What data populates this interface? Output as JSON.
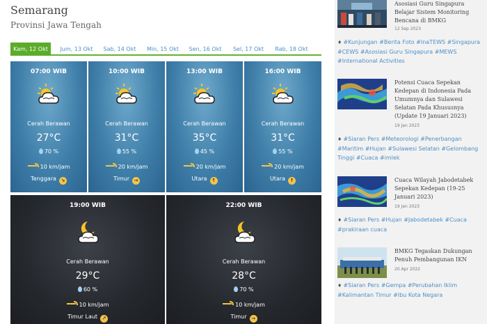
{
  "location": {
    "city": "Semarang",
    "province": "Provinsi Jawa Tengah"
  },
  "tabs": [
    {
      "label": "Kam, 12 Okt",
      "active": true
    },
    {
      "label": "Jum, 13 Okt"
    },
    {
      "label": "Sab, 14 Okt"
    },
    {
      "label": "Min, 15 Okt"
    },
    {
      "label": "Sen, 16 Okt"
    },
    {
      "label": "Sel, 17 Okt"
    },
    {
      "label": "Rab, 18 Okt"
    }
  ],
  "forecasts": [
    {
      "time": "07:00 WIB",
      "condition": "Cerah Berawan",
      "temp": "27°C",
      "humidity": "70 %",
      "wind": "10 km/jam",
      "direction": "Tenggara",
      "period": "day"
    },
    {
      "time": "10:00 WIB",
      "condition": "Cerah Berawan",
      "temp": "31°C",
      "humidity": "55 %",
      "wind": "20 km/jam",
      "direction": "Timur",
      "period": "day"
    },
    {
      "time": "13:00 WIB",
      "condition": "Cerah Berawan",
      "temp": "35°C",
      "humidity": "45 %",
      "wind": "20 km/jam",
      "direction": "Utara",
      "period": "day"
    },
    {
      "time": "16:00 WIB",
      "condition": "Cerah Berawan",
      "temp": "31°C",
      "humidity": "55 %",
      "wind": "20 km/jam",
      "direction": "Utara",
      "period": "day"
    },
    {
      "time": "19:00 WIB",
      "condition": "Cerah Berawan",
      "temp": "29°C",
      "humidity": "60 %",
      "wind": "10 km/jam",
      "direction": "Timur Laut",
      "period": "night"
    },
    {
      "time": "22:00 WIB",
      "condition": "Cerah Berawan",
      "temp": "28°C",
      "humidity": "70 %",
      "wind": "10 km/jam",
      "direction": "Timur",
      "period": "night"
    }
  ],
  "sidebar": {
    "news": [
      {
        "title": "Asosiasi Guru Singapura Belajar Sistem Monitoring Bencana di BMKG",
        "date": "12 Sep 2023",
        "tags": "#Kunjungan #Berita Foto #InaTEWS #Singapura #CEWS #Asosiasi Guru Singapura #MEWS #International Activities"
      },
      {
        "title": "Potensi Cuaca Sepekan Kedepan di Indonesia Pada Umumnya dan Sulawesi Selatan Pada Khususnya (Update 19 Januari 2023)",
        "date": "19 Jan 2023",
        "tags": "#Siaran Pers #Meteorologi #Penerbangan #Maritim #Hujan #Sulawesi Selatan #Gelombang Tinggi #Cuaca #imlek"
      },
      {
        "title": "Cuaca Wilayah Jabodetabek Sepekan Kedepan (19-25 Januari 2023)",
        "date": "19 Jan 2023",
        "tags": "#Siaran Pers #Hujan #Jabodetabek #Cuaca #prakiraan cuaca"
      },
      {
        "title": "BMKG Tegaskan Dukungan Penuh Pembangunan IKN",
        "date": "20 Apr 2022",
        "tags": "#Siaran Pers #Gempa #Perubahan Iklim #Kalimantan Timur #Ibu Kota Negara"
      }
    ]
  }
}
